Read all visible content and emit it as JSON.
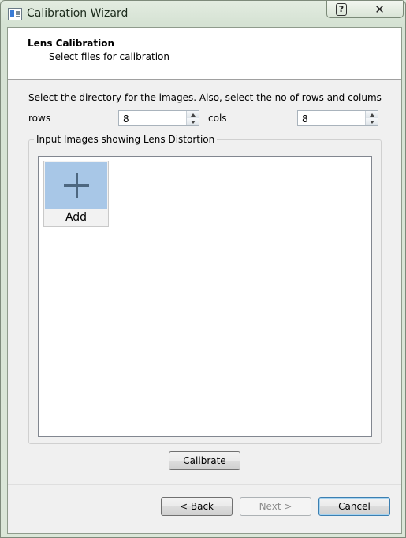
{
  "window": {
    "title": "Calibration Wizard",
    "help_glyph": "?",
    "close_glyph": "✕"
  },
  "header": {
    "title": "Lens Calibration",
    "subtitle": "Select files for calibration"
  },
  "form": {
    "instruction": "Select the directory for the images. Also, select the no of rows and colums",
    "rows_label": "rows",
    "rows_value": "8",
    "cols_label": "cols",
    "cols_value": "8"
  },
  "images_group": {
    "legend": "Input Images showing Lens Distortion",
    "add_label": "Add"
  },
  "buttons": {
    "calibrate": "Calibrate",
    "back": "< Back",
    "next": "Next >",
    "cancel": "Cancel"
  },
  "colors": {
    "add_thumb": "#a8c7e7",
    "plus": "#4d6780"
  }
}
